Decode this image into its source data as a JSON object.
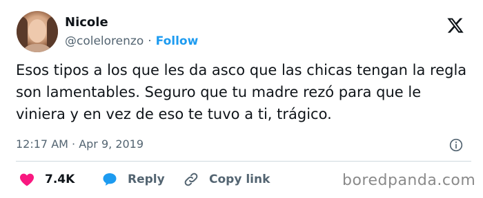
{
  "author": {
    "name": "Nicole",
    "handle": "@colelorenzo",
    "separator": "·",
    "follow_label": "Follow"
  },
  "brand_icon": "x-logo-icon",
  "tweet": {
    "text": "Esos tipos a los que les da asco que las chicas tengan la regla son lamentables. Seguro que tu madre rezó para que le viniera y en vez de eso te tuvo a ti, trágico.",
    "timestamp": "12:17 AM · Apr 9, 2019"
  },
  "actions": {
    "like_count": "7.4K",
    "reply_label": "Reply",
    "copy_label": "Copy link"
  },
  "watermark": "boredpanda.com",
  "colors": {
    "accent": "#1d9bf0",
    "like": "#f91880",
    "muted": "#536471",
    "text": "#0f1419"
  }
}
